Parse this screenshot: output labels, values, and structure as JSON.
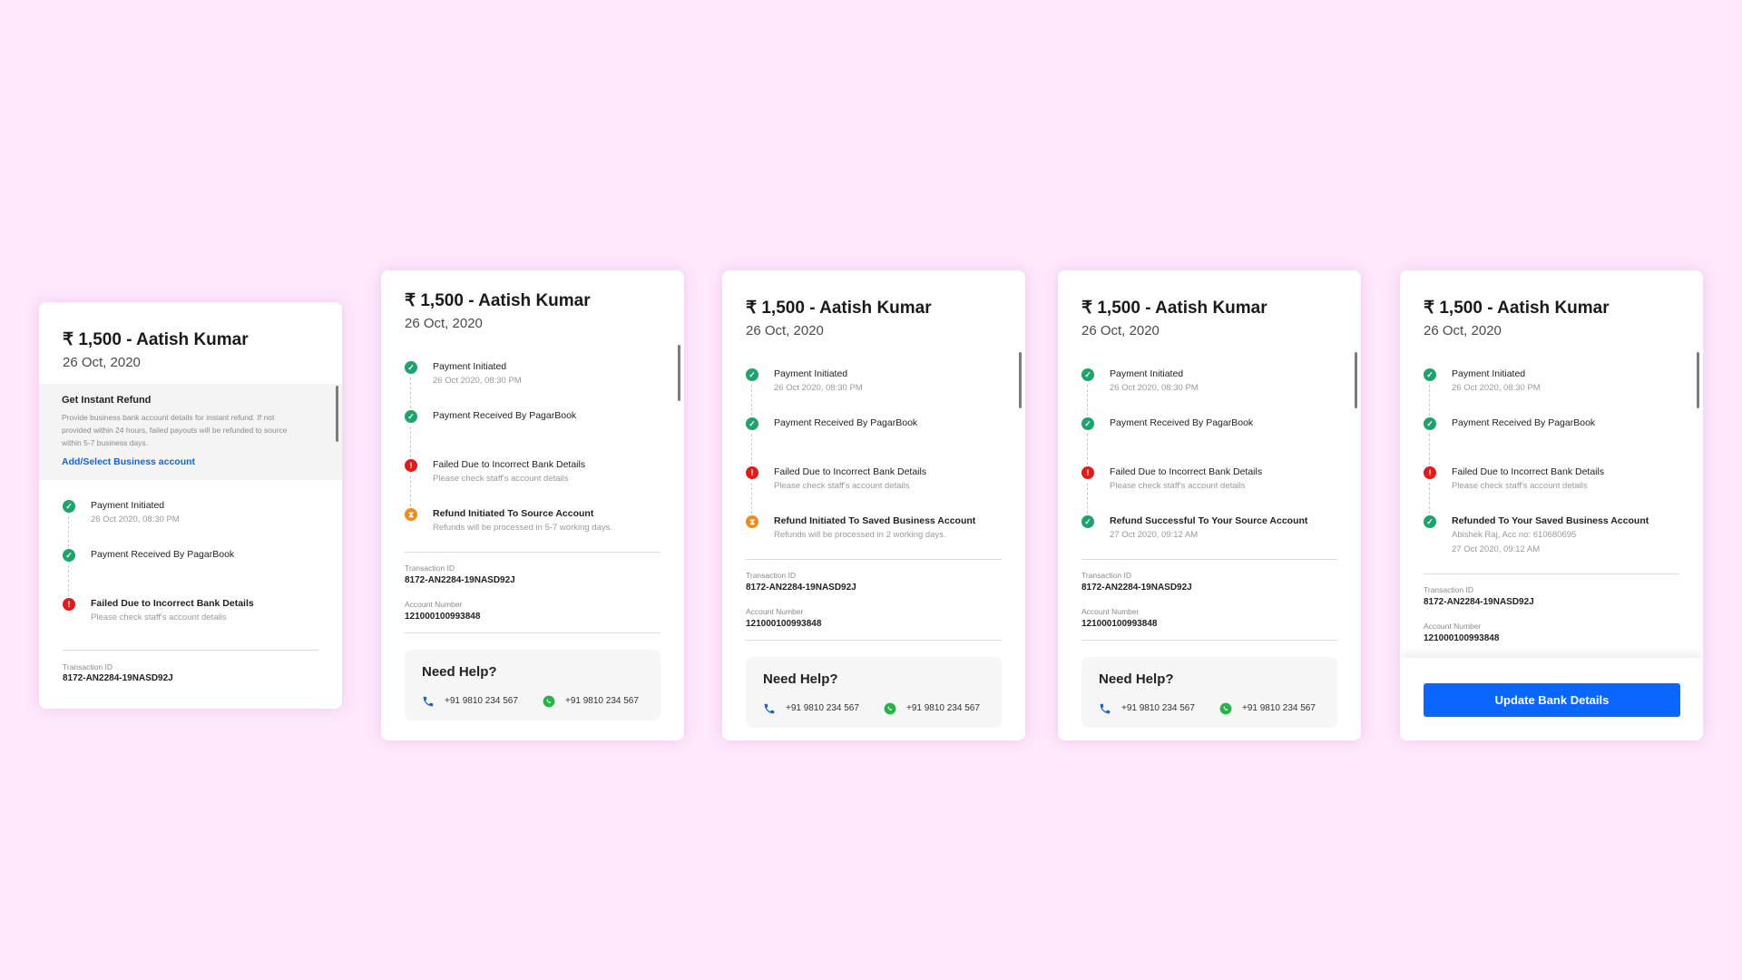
{
  "colors": {
    "background": "#fde9fb",
    "success": "#1fa36d",
    "error": "#e01b1b",
    "warning": "#f08a1d",
    "link": "#0a66e8",
    "primary_button": "#0a66ff",
    "whatsapp": "#2bb24c",
    "phone": "#1463d8"
  },
  "card1": {
    "title": "₹ 1,500 - Aatish Kumar",
    "date": "26 Oct, 2020",
    "refund": {
      "title": "Get Instant Refund",
      "description": "Provide business bank account details for instant refund. If not provided within 24 hours, failed payouts will be refunded to source within 5-7 business days.",
      "link": "Add/Select Business account"
    },
    "timeline": [
      {
        "status": "success",
        "icon": "check-icon",
        "title": "Payment Initiated",
        "sub1": "26 Oct 2020, 08:30 PM"
      },
      {
        "status": "success",
        "icon": "check-icon",
        "title": "Payment Received By PagarBook"
      },
      {
        "status": "error",
        "icon": "error-icon",
        "title": "Failed Due to Incorrect Bank Details",
        "sub1": "Please check staff's account details"
      }
    ],
    "transaction_label": "Transaction ID",
    "transaction_id": "8172-AN2284-19NASD92J"
  },
  "card2": {
    "title": "₹ 1,500 - Aatish Kumar",
    "date": "26 Oct, 2020",
    "timeline": [
      {
        "status": "success",
        "icon": "check-icon",
        "title": "Payment Initiated",
        "sub1": "26 Oct 2020, 08:30 PM"
      },
      {
        "status": "success",
        "icon": "check-icon",
        "title": "Payment Received By PagarBook"
      },
      {
        "status": "error",
        "icon": "error-icon",
        "title": "Failed Due to Incorrect Bank Details",
        "sub1": "Please check staff's account details"
      },
      {
        "status": "pending",
        "icon": "hourglass-icon",
        "title": "Refund Initiated To Source Account",
        "sub1": "Refunds will be processed in 5-7 working days."
      }
    ],
    "transaction_label": "Transaction ID",
    "transaction_id": "8172-AN2284-19NASD92J",
    "account_label": "Account Number",
    "account_number": "121000100993848",
    "help": {
      "title": "Need Help?",
      "phone": "+91 9810 234 567",
      "whatsapp": "+91 9810 234 567"
    }
  },
  "card3": {
    "title": "₹ 1,500 - Aatish Kumar",
    "date": "26 Oct, 2020",
    "timeline": [
      {
        "status": "success",
        "icon": "check-icon",
        "title": "Payment Initiated",
        "sub1": "26 Oct 2020, 08:30 PM"
      },
      {
        "status": "success",
        "icon": "check-icon",
        "title": "Payment Received By PagarBook"
      },
      {
        "status": "error",
        "icon": "error-icon",
        "title": "Failed Due to Incorrect Bank Details",
        "sub1": "Please check staff's account details"
      },
      {
        "status": "pending",
        "icon": "hourglass-icon",
        "title": "Refund Initiated To Saved Business Account",
        "sub1": "Refunds will be processed in 2 working days."
      }
    ],
    "transaction_label": "Transaction ID",
    "transaction_id": "8172-AN2284-19NASD92J",
    "account_label": "Account Number",
    "account_number": "121000100993848",
    "help": {
      "title": "Need Help?",
      "phone": "+91 9810 234 567",
      "whatsapp": "+91 9810 234 567"
    }
  },
  "card4": {
    "title": "₹ 1,500 - Aatish Kumar",
    "date": "26 Oct, 2020",
    "timeline": [
      {
        "status": "success",
        "icon": "check-icon",
        "title": "Payment Initiated",
        "sub1": "26 Oct 2020, 08:30 PM"
      },
      {
        "status": "success",
        "icon": "check-icon",
        "title": "Payment Received By PagarBook"
      },
      {
        "status": "error",
        "icon": "error-icon",
        "title": "Failed Due to Incorrect Bank Details",
        "sub1": "Please check staff's account details"
      },
      {
        "status": "success",
        "icon": "check-icon",
        "title": "Refund Successful To Your Source Account",
        "sub1": "27 Oct 2020, 09:12 AM"
      }
    ],
    "transaction_label": "Transaction ID",
    "transaction_id": "8172-AN2284-19NASD92J",
    "account_label": "Account Number",
    "account_number": "121000100993848",
    "help": {
      "title": "Need Help?",
      "phone": "+91 9810 234 567",
      "whatsapp": "+91 9810 234 567"
    }
  },
  "card5": {
    "title": "₹ 1,500 - Aatish Kumar",
    "date": "26 Oct, 2020",
    "timeline": [
      {
        "status": "success",
        "icon": "check-icon",
        "title": "Payment Initiated",
        "sub1": "26 Oct 2020, 08:30 PM"
      },
      {
        "status": "success",
        "icon": "check-icon",
        "title": "Payment Received By PagarBook"
      },
      {
        "status": "error",
        "icon": "error-icon",
        "title": "Failed Due to Incorrect Bank Details",
        "sub1": "Please check staff's account details"
      },
      {
        "status": "success",
        "icon": "check-icon",
        "title": "Refunded To Your Saved Business Account",
        "sub1": "Abishek Raj, Acc no: 610680695",
        "sub2": "27 Oct 2020, 09:12 AM"
      }
    ],
    "transaction_label": "Transaction ID",
    "transaction_id": "8172-AN2284-19NASD92J",
    "account_label": "Account Number",
    "account_number": "121000100993848",
    "button": "Update Bank Details"
  }
}
